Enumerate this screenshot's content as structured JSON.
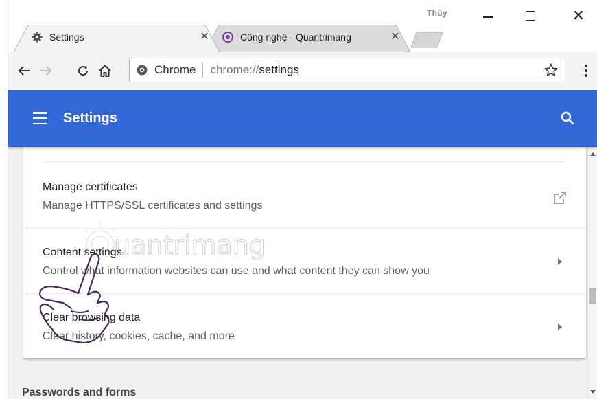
{
  "window": {
    "user_name": "Thủy",
    "minimize_label": "Minimize",
    "maximize_label": "Maximize",
    "close_label": "Close"
  },
  "tabs": [
    {
      "title": "Settings",
      "icon": "gear-icon",
      "active": true
    },
    {
      "title": "Công nghệ - Quantrimang",
      "icon": "quantrimang-logo-icon",
      "active": false
    }
  ],
  "toolbar": {
    "omnibox_label": "Chrome",
    "url_scheme": "chrome://",
    "url_path": "settings"
  },
  "header": {
    "title": "Settings"
  },
  "settings_rows": [
    {
      "title": "Manage certificates",
      "subtitle": "Manage HTTPS/SSL certificates and settings",
      "trailing": "external-link-icon"
    },
    {
      "title": "Content settings",
      "subtitle": "Control what information websites can use and what content they can show you",
      "trailing": "chevron-right-icon"
    },
    {
      "title": "Clear browsing data",
      "subtitle": "Clear history, cookies, cache, and more",
      "trailing": "chevron-right-icon"
    }
  ],
  "next_section": {
    "title": "Passwords and forms"
  },
  "watermark": {
    "text": "uantrimang"
  },
  "colors": {
    "header_blue": "#3367d6",
    "page_background": "#f1f1f1",
    "tab_icon_purple": "#7b3fa0"
  }
}
